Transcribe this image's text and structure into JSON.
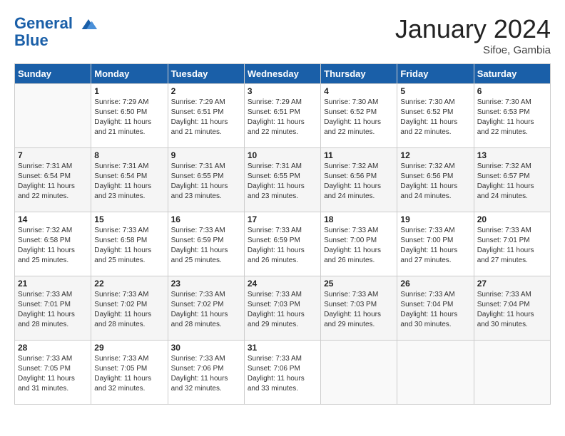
{
  "header": {
    "logo_line1": "General",
    "logo_line2": "Blue",
    "month_title": "January 2024",
    "location": "Sifoe, Gambia"
  },
  "days_of_week": [
    "Sunday",
    "Monday",
    "Tuesday",
    "Wednesday",
    "Thursday",
    "Friday",
    "Saturday"
  ],
  "weeks": [
    [
      {
        "day": "",
        "sunrise": "",
        "sunset": "",
        "daylight": ""
      },
      {
        "day": "1",
        "sunrise": "Sunrise: 7:29 AM",
        "sunset": "Sunset: 6:50 PM",
        "daylight": "Daylight: 11 hours and 21 minutes."
      },
      {
        "day": "2",
        "sunrise": "Sunrise: 7:29 AM",
        "sunset": "Sunset: 6:51 PM",
        "daylight": "Daylight: 11 hours and 21 minutes."
      },
      {
        "day": "3",
        "sunrise": "Sunrise: 7:29 AM",
        "sunset": "Sunset: 6:51 PM",
        "daylight": "Daylight: 11 hours and 22 minutes."
      },
      {
        "day": "4",
        "sunrise": "Sunrise: 7:30 AM",
        "sunset": "Sunset: 6:52 PM",
        "daylight": "Daylight: 11 hours and 22 minutes."
      },
      {
        "day": "5",
        "sunrise": "Sunrise: 7:30 AM",
        "sunset": "Sunset: 6:52 PM",
        "daylight": "Daylight: 11 hours and 22 minutes."
      },
      {
        "day": "6",
        "sunrise": "Sunrise: 7:30 AM",
        "sunset": "Sunset: 6:53 PM",
        "daylight": "Daylight: 11 hours and 22 minutes."
      }
    ],
    [
      {
        "day": "7",
        "sunrise": "Sunrise: 7:31 AM",
        "sunset": "Sunset: 6:54 PM",
        "daylight": "Daylight: 11 hours and 22 minutes."
      },
      {
        "day": "8",
        "sunrise": "Sunrise: 7:31 AM",
        "sunset": "Sunset: 6:54 PM",
        "daylight": "Daylight: 11 hours and 23 minutes."
      },
      {
        "day": "9",
        "sunrise": "Sunrise: 7:31 AM",
        "sunset": "Sunset: 6:55 PM",
        "daylight": "Daylight: 11 hours and 23 minutes."
      },
      {
        "day": "10",
        "sunrise": "Sunrise: 7:31 AM",
        "sunset": "Sunset: 6:55 PM",
        "daylight": "Daylight: 11 hours and 23 minutes."
      },
      {
        "day": "11",
        "sunrise": "Sunrise: 7:32 AM",
        "sunset": "Sunset: 6:56 PM",
        "daylight": "Daylight: 11 hours and 24 minutes."
      },
      {
        "day": "12",
        "sunrise": "Sunrise: 7:32 AM",
        "sunset": "Sunset: 6:56 PM",
        "daylight": "Daylight: 11 hours and 24 minutes."
      },
      {
        "day": "13",
        "sunrise": "Sunrise: 7:32 AM",
        "sunset": "Sunset: 6:57 PM",
        "daylight": "Daylight: 11 hours and 24 minutes."
      }
    ],
    [
      {
        "day": "14",
        "sunrise": "Sunrise: 7:32 AM",
        "sunset": "Sunset: 6:58 PM",
        "daylight": "Daylight: 11 hours and 25 minutes."
      },
      {
        "day": "15",
        "sunrise": "Sunrise: 7:33 AM",
        "sunset": "Sunset: 6:58 PM",
        "daylight": "Daylight: 11 hours and 25 minutes."
      },
      {
        "day": "16",
        "sunrise": "Sunrise: 7:33 AM",
        "sunset": "Sunset: 6:59 PM",
        "daylight": "Daylight: 11 hours and 25 minutes."
      },
      {
        "day": "17",
        "sunrise": "Sunrise: 7:33 AM",
        "sunset": "Sunset: 6:59 PM",
        "daylight": "Daylight: 11 hours and 26 minutes."
      },
      {
        "day": "18",
        "sunrise": "Sunrise: 7:33 AM",
        "sunset": "Sunset: 7:00 PM",
        "daylight": "Daylight: 11 hours and 26 minutes."
      },
      {
        "day": "19",
        "sunrise": "Sunrise: 7:33 AM",
        "sunset": "Sunset: 7:00 PM",
        "daylight": "Daylight: 11 hours and 27 minutes."
      },
      {
        "day": "20",
        "sunrise": "Sunrise: 7:33 AM",
        "sunset": "Sunset: 7:01 PM",
        "daylight": "Daylight: 11 hours and 27 minutes."
      }
    ],
    [
      {
        "day": "21",
        "sunrise": "Sunrise: 7:33 AM",
        "sunset": "Sunset: 7:01 PM",
        "daylight": "Daylight: 11 hours and 28 minutes."
      },
      {
        "day": "22",
        "sunrise": "Sunrise: 7:33 AM",
        "sunset": "Sunset: 7:02 PM",
        "daylight": "Daylight: 11 hours and 28 minutes."
      },
      {
        "day": "23",
        "sunrise": "Sunrise: 7:33 AM",
        "sunset": "Sunset: 7:02 PM",
        "daylight": "Daylight: 11 hours and 28 minutes."
      },
      {
        "day": "24",
        "sunrise": "Sunrise: 7:33 AM",
        "sunset": "Sunset: 7:03 PM",
        "daylight": "Daylight: 11 hours and 29 minutes."
      },
      {
        "day": "25",
        "sunrise": "Sunrise: 7:33 AM",
        "sunset": "Sunset: 7:03 PM",
        "daylight": "Daylight: 11 hours and 29 minutes."
      },
      {
        "day": "26",
        "sunrise": "Sunrise: 7:33 AM",
        "sunset": "Sunset: 7:04 PM",
        "daylight": "Daylight: 11 hours and 30 minutes."
      },
      {
        "day": "27",
        "sunrise": "Sunrise: 7:33 AM",
        "sunset": "Sunset: 7:04 PM",
        "daylight": "Daylight: 11 hours and 30 minutes."
      }
    ],
    [
      {
        "day": "28",
        "sunrise": "Sunrise: 7:33 AM",
        "sunset": "Sunset: 7:05 PM",
        "daylight": "Daylight: 11 hours and 31 minutes."
      },
      {
        "day": "29",
        "sunrise": "Sunrise: 7:33 AM",
        "sunset": "Sunset: 7:05 PM",
        "daylight": "Daylight: 11 hours and 32 minutes."
      },
      {
        "day": "30",
        "sunrise": "Sunrise: 7:33 AM",
        "sunset": "Sunset: 7:06 PM",
        "daylight": "Daylight: 11 hours and 32 minutes."
      },
      {
        "day": "31",
        "sunrise": "Sunrise: 7:33 AM",
        "sunset": "Sunset: 7:06 PM",
        "daylight": "Daylight: 11 hours and 33 minutes."
      },
      {
        "day": "",
        "sunrise": "",
        "sunset": "",
        "daylight": ""
      },
      {
        "day": "",
        "sunrise": "",
        "sunset": "",
        "daylight": ""
      },
      {
        "day": "",
        "sunrise": "",
        "sunset": "",
        "daylight": ""
      }
    ]
  ]
}
